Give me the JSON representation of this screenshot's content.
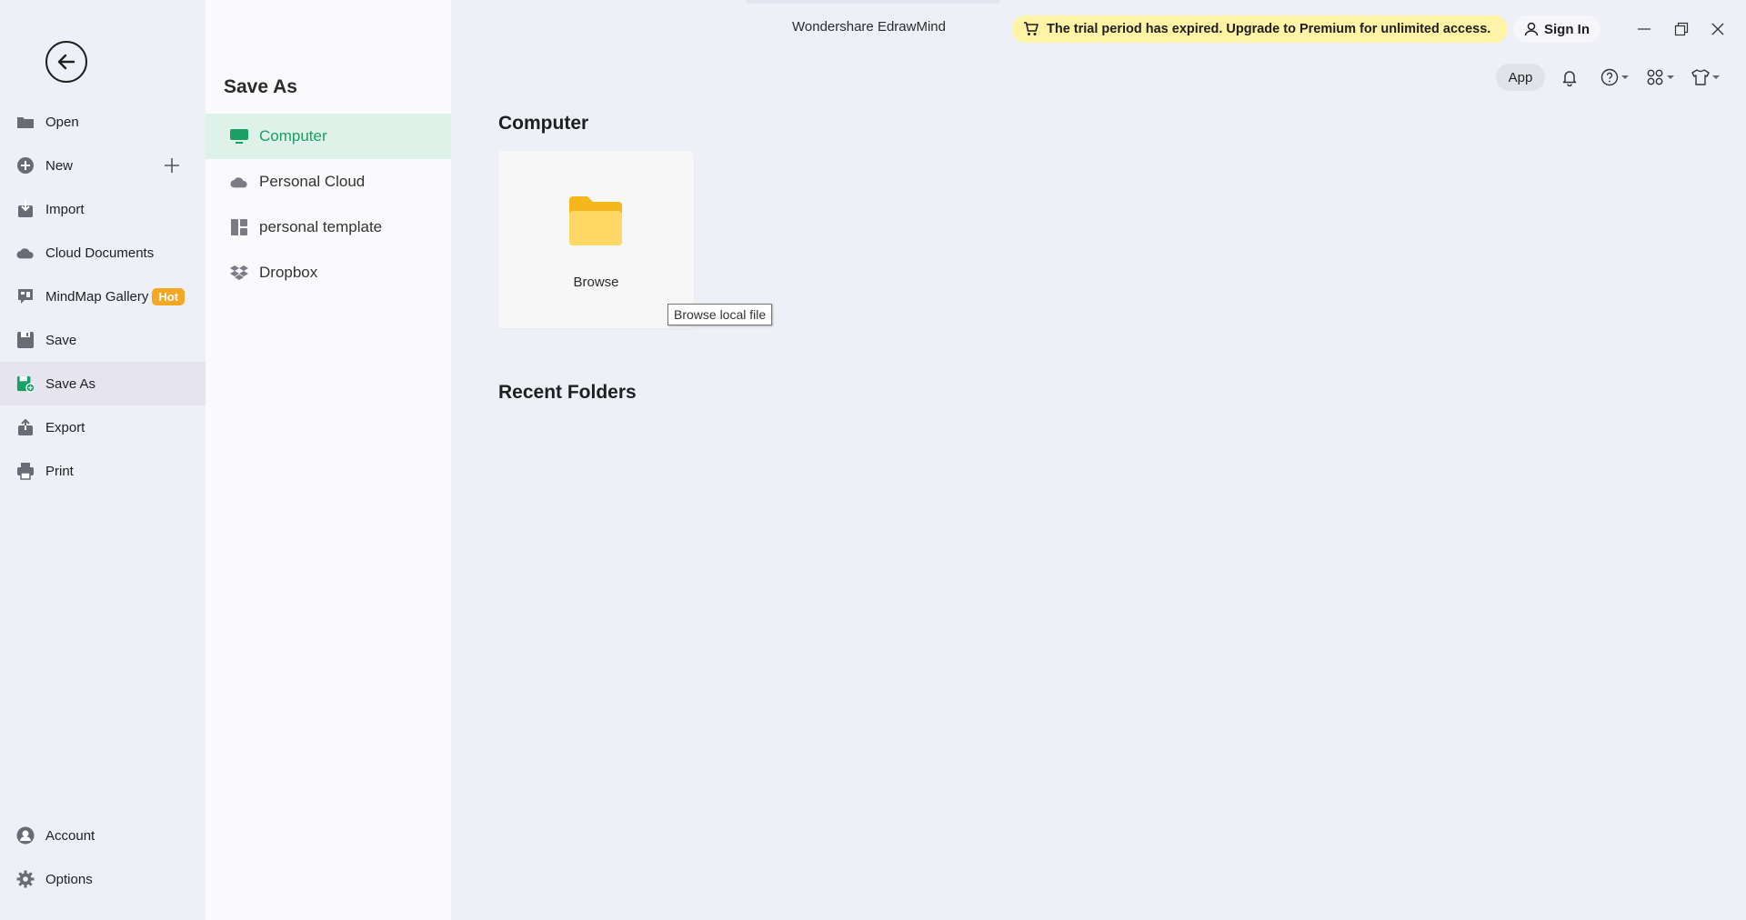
{
  "app": {
    "title": "Wondershare EdrawMind"
  },
  "trial_banner": {
    "text": "The trial period has expired. Upgrade to Premium for unlimited access."
  },
  "header": {
    "sign_in": "Sign In",
    "app_button": "App"
  },
  "leftnav": {
    "items": [
      {
        "label": "Open",
        "icon": "folder-icon"
      },
      {
        "label": "New",
        "icon": "plus-circle-icon"
      },
      {
        "label": "Import",
        "icon": "import-icon"
      },
      {
        "label": "Cloud Documents",
        "icon": "cloud-icon"
      },
      {
        "label": "MindMap Gallery",
        "icon": "gallery-icon",
        "badge": "Hot"
      },
      {
        "label": "Save",
        "icon": "save-icon"
      },
      {
        "label": "Save As",
        "icon": "save-as-icon",
        "active": true
      },
      {
        "label": "Export",
        "icon": "export-icon"
      },
      {
        "label": "Print",
        "icon": "print-icon"
      }
    ],
    "bottom": [
      {
        "label": "Account",
        "icon": "account-icon"
      },
      {
        "label": "Options",
        "icon": "gear-icon"
      }
    ]
  },
  "midpanel": {
    "title": "Save As",
    "locations": [
      {
        "label": "Computer",
        "icon": "monitor-icon",
        "active": true
      },
      {
        "label": "Personal Cloud",
        "icon": "cloud-icon"
      },
      {
        "label": "personal template",
        "icon": "template-icon"
      },
      {
        "label": "Dropbox",
        "icon": "dropbox-icon"
      }
    ]
  },
  "main": {
    "computer_title": "Computer",
    "browse_label": "Browse",
    "tooltip": "Browse local file",
    "recent_title": "Recent Folders"
  },
  "colors": {
    "accent_green": "#1aa064",
    "banner_yellow": "#fff3a6",
    "hot_badge": "#f5a623",
    "folder_yellow": "#ffc83d"
  }
}
